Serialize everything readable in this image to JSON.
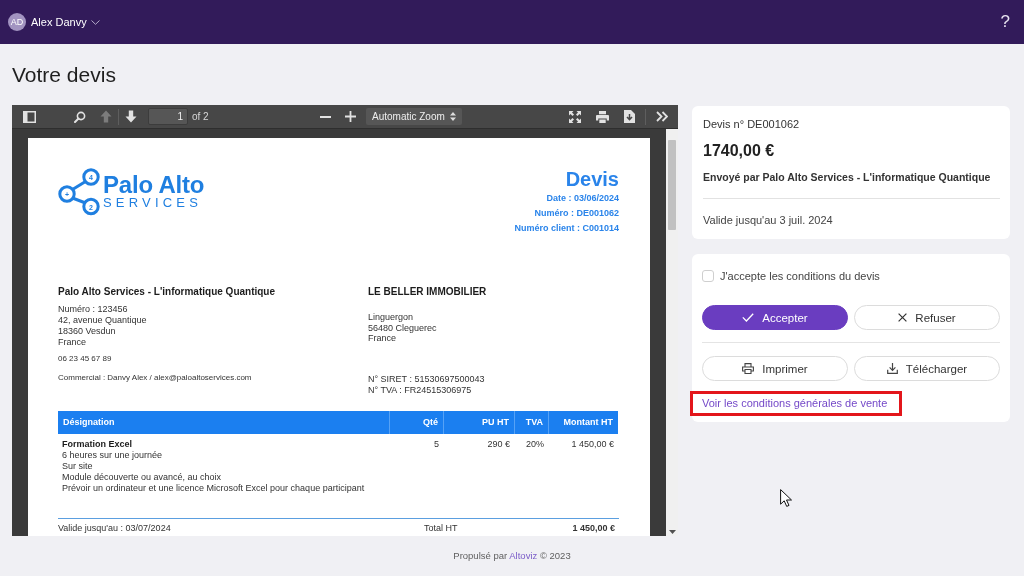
{
  "top_bar": {
    "user": {
      "initials": "AD",
      "name": "Alex Danvy"
    },
    "help": "?"
  },
  "page_title": "Votre devis",
  "pdf_viewer": {
    "toolbar": {
      "previous_page_disabled": true,
      "next_page_disabled": false,
      "page": "1",
      "page_count": "of 2",
      "zoom": "Automatic Zoom"
    },
    "document": {
      "logo": {
        "name": "Palo Alto",
        "tagline": "SERVICES",
        "node_labels": [
          "4",
          "+",
          "2"
        ]
      },
      "title": "Devis",
      "meta": [
        "Date : 03/06/2024",
        "Numéro : DE001062",
        "Numéro client : C001014"
      ],
      "sender": {
        "name": "Palo Alto Services - L'informatique Quantique",
        "address": [
          "Numéro : 123456",
          "42, avenue Quantique",
          "18360 Vesdun",
          "France"
        ],
        "phone": "06 23 45 67 89",
        "contact": "Commercial : Danvy Alex / alex@paloaltoservices.com"
      },
      "recipient": {
        "name": "LE BELLER IMMOBILIER",
        "address": [
          "Linguergon",
          "56480 Cleguerec",
          "France"
        ],
        "registration": [
          "N° SIRET : 51530697500043",
          "N° TVA : FR24515306975"
        ]
      },
      "table": {
        "columns": [
          "Désignation",
          "Qté",
          "PU HT",
          "TVA",
          "Montant HT"
        ],
        "rows": [
          {
            "title": "Formation Excel",
            "details": [
              "6 heures sur une journée",
              "Sur site",
              "Module découverte ou avancé, au choix",
              "Prévoir un ordinateur et une licence Microsoft Excel pour chaque participant"
            ],
            "quantity": "5",
            "unit_price": "290 €",
            "vat": "20%",
            "amount": "1 450,00 €"
          }
        ]
      },
      "validity": "Valide jusqu'au : 03/07/2024",
      "totals": [
        {
          "label": "Total HT",
          "value": "1 450,00 €"
        }
      ]
    }
  },
  "summary_card": {
    "reference": "Devis n° DE001062",
    "amount": "1740,00 €",
    "sender": "Envoyé par Palo Alto Services - L'informatique Quantique",
    "validity": "Valide jusqu'au 3 juil. 2024"
  },
  "actions_card": {
    "consent": {
      "label": "J'accepte les conditions du devis",
      "checked": false
    },
    "decision_buttons": [
      {
        "kind": "accept",
        "label": "Accepter"
      },
      {
        "kind": "refuse",
        "label": "Refuser"
      }
    ],
    "document_buttons": [
      {
        "kind": "print",
        "label": "Imprimer"
      },
      {
        "kind": "download",
        "label": "Télécharger"
      }
    ],
    "terms_link": {
      "label": "Voir les conditions générales de vente",
      "highlighted": true
    }
  },
  "footer": {
    "prefix": "Propulsé par",
    "link": "Altoviz",
    "suffix": "© 2023"
  }
}
